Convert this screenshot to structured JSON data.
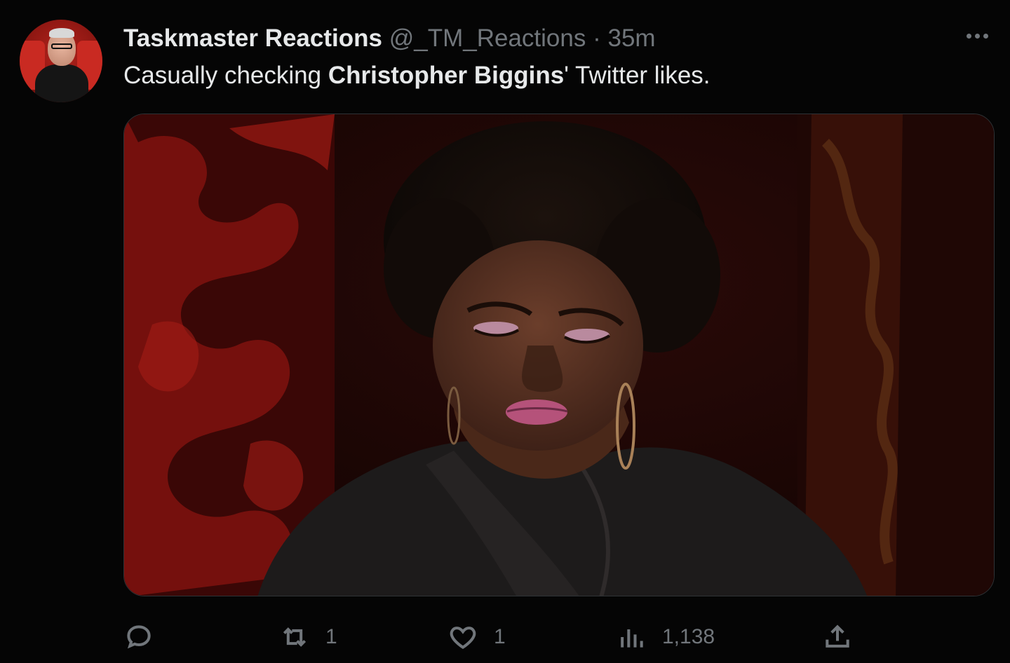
{
  "tweet": {
    "display_name": "Taskmaster Reactions",
    "handle": "@_TM_Reactions",
    "separator": "·",
    "time": "35m",
    "text_before": "Casually checking ",
    "text_bold": "Christopher Biggins",
    "text_after": "' Twitter likes.",
    "media_description_icon": "video-frame"
  },
  "actions": {
    "reply_count": "",
    "retweet_count": "1",
    "like_count": "1",
    "views_count": "1,138"
  },
  "icons": {
    "more": "more-icon",
    "reply": "reply-icon",
    "retweet": "retweet-icon",
    "like": "heart-icon",
    "views": "views-icon",
    "share": "share-icon"
  },
  "colors": {
    "background": "#050505",
    "text_primary": "#e7e9ea",
    "text_secondary": "#71767b",
    "border": "#2f3336"
  }
}
